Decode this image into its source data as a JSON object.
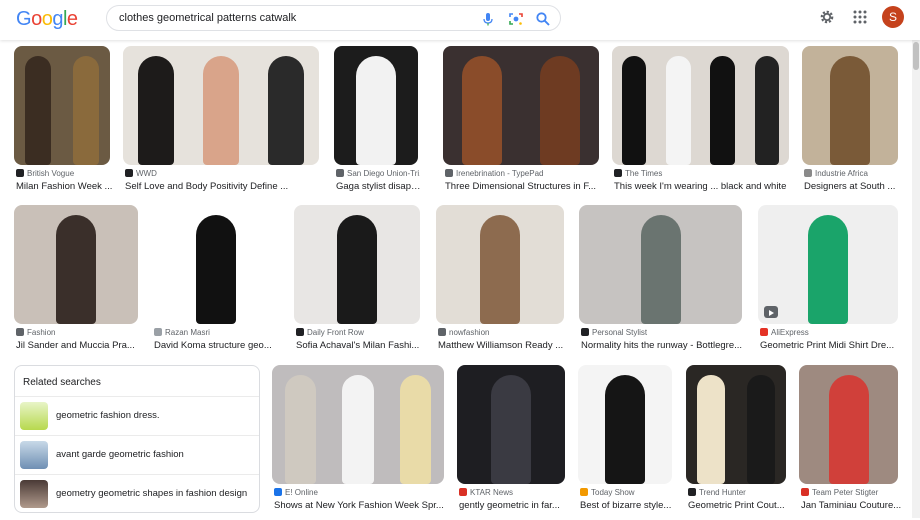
{
  "header": {
    "logo": "Google",
    "logo_colors": [
      "#4285F4",
      "#EA4335",
      "#FBBC05",
      "#4285F4",
      "#34A853",
      "#EA4335"
    ],
    "query": "clothes geometrical patterns catwalk",
    "avatar_letter": "S",
    "avatar_color": "#c5421c"
  },
  "row1": [
    {
      "source": "British Vogue",
      "caption": "Milan Fashion Week ...",
      "fav": "#202124"
    },
    {
      "source": "WWD",
      "caption": "Self Love and Body Positivity Define ...",
      "fav": "#202124"
    },
    {
      "source": "San Diego Union-Tri...",
      "caption": "Gaga stylist disapp...",
      "fav": "#5f6368"
    },
    {
      "source": "Irenebrination - TypePad",
      "caption": "Three Dimensional Structures in F...",
      "fav": "#5f6368"
    },
    {
      "source": "The Times",
      "caption": "This week I'm wearing ... black and white",
      "fav": "#202124"
    },
    {
      "source": "Industrie Africa",
      "caption": "Designers at South ...",
      "fav": "#8a8a8a"
    }
  ],
  "row2": [
    {
      "source": "Fashion",
      "caption": "Jil Sander and Muccia Pra...",
      "fav": "#5f6368"
    },
    {
      "source": "Razan Masri",
      "caption": "David Koma structure geo...",
      "fav": "#9aa0a6"
    },
    {
      "source": "Daily Front Row",
      "caption": "Sofia Achaval's Milan Fashi...",
      "fav": "#202124"
    },
    {
      "source": "nowfashion",
      "caption": "Matthew Williamson Ready ...",
      "fav": "#5f6368"
    },
    {
      "source": "Personal Stylist",
      "caption": "Normality hits the runway - Bottlegre...",
      "fav": "#202124"
    },
    {
      "source": "AliExpress",
      "caption": "Geometric Print Midi Shirt Dre...",
      "fav": "#e43225"
    }
  ],
  "row3": [
    {
      "source": "E! Online",
      "caption": "Shows at New York Fashion Week Spr...",
      "fav": "#1a73e8"
    },
    {
      "source": "KTAR News",
      "caption": "gently geometric in far...",
      "fav": "#d93025"
    },
    {
      "source": "Today Show",
      "caption": "Best of bizarre style...",
      "fav": "#f29900"
    },
    {
      "source": "Trend Hunter",
      "caption": "Geometric Print Cout...",
      "fav": "#202124"
    },
    {
      "source": "Team Peter Stigter",
      "caption": "Jan Taminiau Couture...",
      "fav": "#d93025"
    }
  ],
  "related": {
    "heading": "Related searches",
    "items": [
      {
        "label": "geometric fashion dress."
      },
      {
        "label": "avant garde geometric fashion"
      },
      {
        "label": "geometry geometric shapes in fashion design"
      }
    ]
  }
}
